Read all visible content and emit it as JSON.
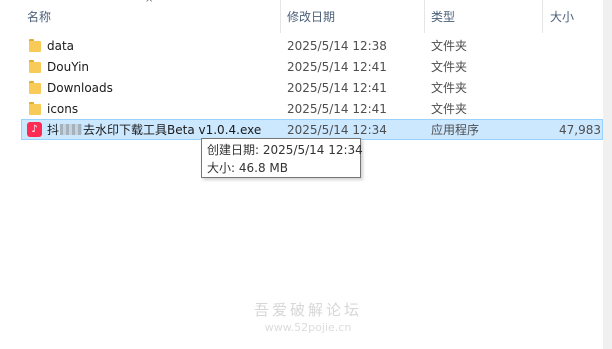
{
  "columns": {
    "name": "名称",
    "date_modified": "修改日期",
    "type": "类型",
    "size": "大小"
  },
  "rows": [
    {
      "name": "data",
      "date": "2025/5/14 12:38",
      "type": "文件夹",
      "size": "",
      "icon": "folder-icon"
    },
    {
      "name": "DouYin",
      "date": "2025/5/14 12:41",
      "type": "文件夹",
      "size": "",
      "icon": "folder-icon"
    },
    {
      "name": "Downloads",
      "date": "2025/5/14 12:41",
      "type": "文件夹",
      "size": "",
      "icon": "folder-icon"
    },
    {
      "name": "icons",
      "date": "2025/5/14 12:41",
      "type": "文件夹",
      "size": "",
      "icon": "folder-icon"
    }
  ],
  "selected_file": {
    "name_prefix": "抖",
    "name_suffix": "去水印下载工具Beta v1.0.4.exe",
    "date": "2025/5/14 12:34",
    "type": "应用程序",
    "size": "47,983",
    "icon": "tiktok-app-icon"
  },
  "tooltip": {
    "created": "创建日期: 2025/5/14 12:34",
    "size": "大小: 46.8 MB"
  },
  "watermark": {
    "title": "吾爱破解论坛",
    "url": "www.52pojie.cn"
  },
  "colors": {
    "selection": "#cce8ff",
    "selection_border": "#99d1ff",
    "folder": "#f8cb58",
    "app_icon": "#fe2c55",
    "header_text": "#4c607a"
  }
}
